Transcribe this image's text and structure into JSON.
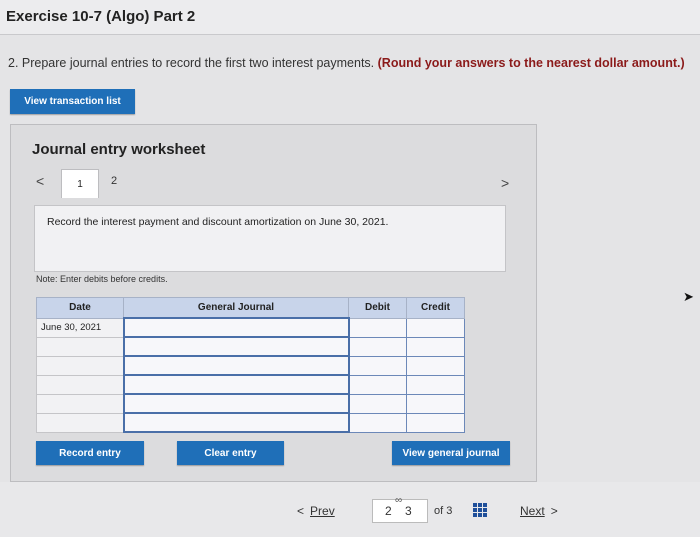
{
  "header": {
    "title": "Exercise 10-7 (Algo) Part 2"
  },
  "question": {
    "text": "2. Prepare journal entries to record the first two interest payments.",
    "emphasis": "(Round your answers to the nearest dollar amount.)"
  },
  "buttons": {
    "view_transaction_list": "View transaction list",
    "record_entry": "Record entry",
    "clear_entry": "Clear entry",
    "view_general_journal": "View general journal"
  },
  "worksheet": {
    "title": "Journal entry worksheet",
    "nav_prev": "<",
    "nav_next": ">",
    "tabs": [
      "1",
      "2"
    ],
    "description": "Record the interest payment and discount amortization on June 30, 2021.",
    "note": "Note: Enter debits before credits."
  },
  "journal_table": {
    "headers": [
      "Date",
      "General Journal",
      "Debit",
      "Credit"
    ],
    "rows": [
      {
        "date": "June 30, 2021",
        "account": "",
        "debit": "",
        "credit": ""
      },
      {
        "date": "",
        "account": "",
        "debit": "",
        "credit": ""
      },
      {
        "date": "",
        "account": "",
        "debit": "",
        "credit": ""
      },
      {
        "date": "",
        "account": "",
        "debit": "",
        "credit": ""
      },
      {
        "date": "",
        "account": "",
        "debit": "",
        "credit": ""
      },
      {
        "date": "",
        "account": "",
        "debit": "",
        "credit": ""
      }
    ]
  },
  "pagination": {
    "prev_label": "Prev",
    "prev_symbol": "<",
    "page_prev": "2",
    "page_current": "3",
    "of_text": "of 3",
    "next_label": "Next",
    "next_symbol": ">",
    "link_glyph": "∞"
  },
  "colors": {
    "accent": "#1f6fb8",
    "emphasis": "#8b1a1a",
    "table_header": "#c8d4ea",
    "input_border": "#4a6fa8"
  }
}
